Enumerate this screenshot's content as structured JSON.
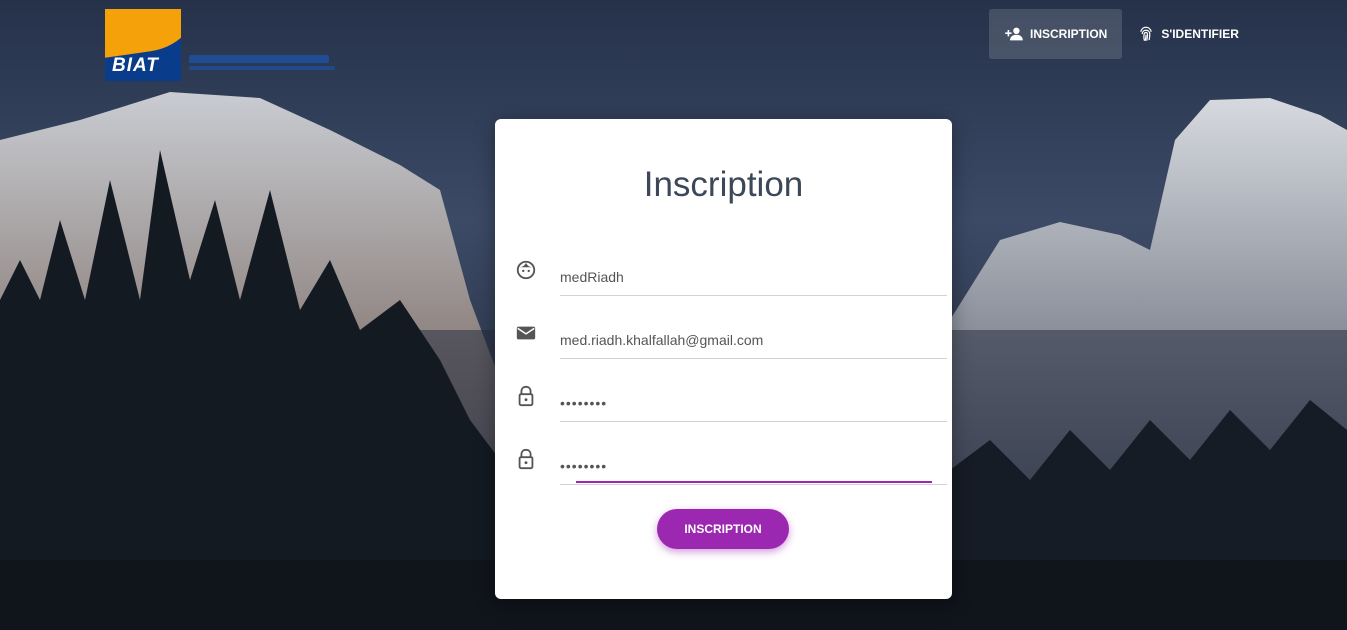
{
  "brand": {
    "logo_text": "BIAT",
    "logo_colors": {
      "primary": "#0a3c8c",
      "accent": "#f5a10a"
    }
  },
  "nav": {
    "items": [
      {
        "label": "INSCRIPTION",
        "icon": "person-add-icon",
        "active": true
      },
      {
        "label": "S'IDENTIFIER",
        "icon": "fingerprint-icon",
        "active": false
      }
    ]
  },
  "form": {
    "title": "Inscription",
    "fields": [
      {
        "name": "username",
        "icon": "face-icon",
        "value": "medRiadh"
      },
      {
        "name": "email",
        "icon": "mail-icon",
        "value": "med.riadh.khalfallah@gmail.com"
      },
      {
        "name": "password",
        "icon": "lock-icon",
        "value": "••••••••"
      },
      {
        "name": "confirm_password",
        "icon": "lock-icon",
        "value": "••••••••"
      }
    ],
    "submit_label": "INSCRIPTION",
    "accent_color": "#9c27b0"
  }
}
